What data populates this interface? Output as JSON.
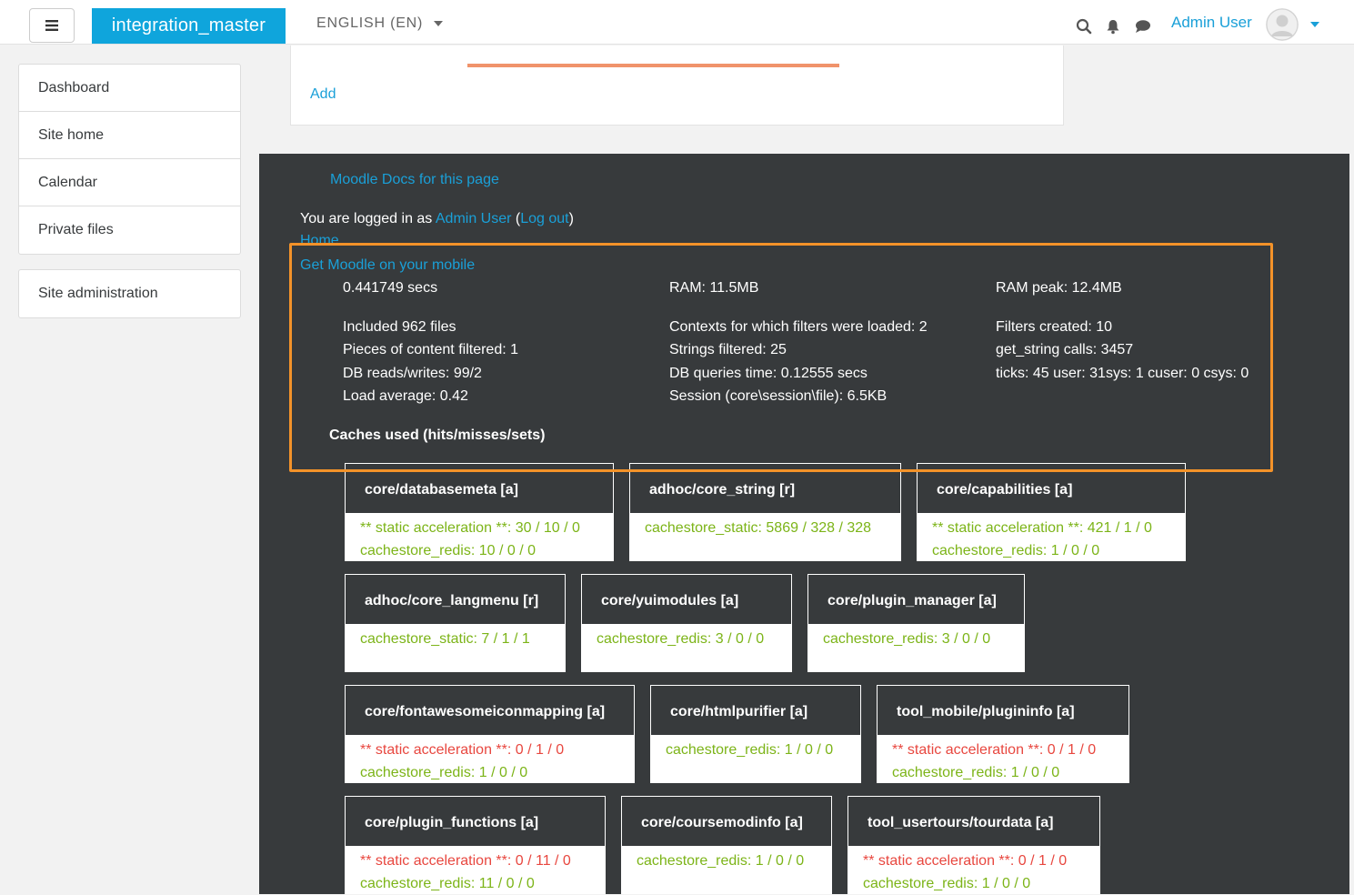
{
  "navbar": {
    "brand": "integration_master",
    "language": "ENGLISH (EN)",
    "user_name": "Admin User",
    "icons": [
      "hamburger-icon",
      "search-icon",
      "bell-icon",
      "chat-icon",
      "avatar-icon",
      "chevron-down-icon"
    ]
  },
  "sidebar": {
    "items": [
      "Dashboard",
      "Site home",
      "Calendar",
      "Private files"
    ],
    "admin": "Site administration"
  },
  "content": {
    "add_label": "Add"
  },
  "footer": {
    "docs_link": "Moodle Docs for this page",
    "logged_in_prefix": "You are logged in as ",
    "logged_in_user": "Admin User",
    "paren_open": " (",
    "logout": "Log out",
    "paren_close": ")",
    "home_link": "Home",
    "mobile_link": "Get Moodle on your mobile"
  },
  "performance": {
    "col1": [
      "0.441749 secs",
      "Included 962 files",
      "Pieces of content filtered: 1",
      "DB reads/writes: 99/2",
      "Load average: 0.42"
    ],
    "col2": [
      "RAM: 11.5MB",
      "Contexts for which filters were loaded: 2",
      "Strings filtered: 25",
      "DB queries time: 0.12555 secs",
      "Session (core\\session\\file): 6.5KB"
    ],
    "col3": [
      "RAM peak: 12.4MB",
      "Filters created: 10",
      "get_string calls: 3457",
      "ticks: 45 user: 31sys: 1 cuser: 0 csys: 0"
    ],
    "caches_title": "Caches used (hits/misses/sets)"
  },
  "caches": [
    {
      "name": "core/databasemeta [a]",
      "lines": [
        {
          "text": "** static acceleration **: 30 / 10 / 0",
          "status": "green"
        },
        {
          "text": "cachestore_redis: 10 / 0 / 0",
          "status": "green"
        }
      ]
    },
    {
      "name": "adhoc/core_string [r]",
      "lines": [
        {
          "text": "cachestore_static: 5869 / 328 / 328",
          "status": "green"
        }
      ]
    },
    {
      "name": "core/capabilities [a]",
      "lines": [
        {
          "text": "** static acceleration **: 421 / 1 / 0",
          "status": "green"
        },
        {
          "text": "cachestore_redis: 1 / 0 / 0",
          "status": "green"
        }
      ]
    },
    {
      "name": "adhoc/core_langmenu [r]",
      "lines": [
        {
          "text": "cachestore_static: 7 / 1 / 1",
          "status": "green"
        }
      ]
    },
    {
      "name": "core/yuimodules [a]",
      "lines": [
        {
          "text": "cachestore_redis: 3 / 0 / 0",
          "status": "green"
        }
      ]
    },
    {
      "name": "core/plugin_manager [a]",
      "lines": [
        {
          "text": "cachestore_redis: 3 / 0 / 0",
          "status": "green"
        }
      ]
    },
    {
      "name": "core/fontawesomeiconmapping [a]",
      "lines": [
        {
          "text": "** static acceleration **: 0 / 1 / 0",
          "status": "red"
        },
        {
          "text": "cachestore_redis: 1 / 0 / 0",
          "status": "green"
        }
      ]
    },
    {
      "name": "core/htmlpurifier [a]",
      "lines": [
        {
          "text": "cachestore_redis: 1 / 0 / 0",
          "status": "green"
        }
      ]
    },
    {
      "name": "tool_mobile/plugininfo [a]",
      "lines": [
        {
          "text": "** static acceleration **: 0 / 1 / 0",
          "status": "red"
        },
        {
          "text": "cachestore_redis: 1 / 0 / 0",
          "status": "green"
        }
      ]
    },
    {
      "name": "core/plugin_functions [a]",
      "lines": [
        {
          "text": "** static acceleration **: 0 / 11 / 0",
          "status": "red"
        },
        {
          "text": "cachestore_redis: 11 / 0 / 0",
          "status": "green"
        }
      ]
    },
    {
      "name": "core/coursemodinfo [a]",
      "lines": [
        {
          "text": "cachestore_redis: 1 / 0 / 0",
          "status": "green"
        }
      ]
    },
    {
      "name": "tool_usertours/tourdata [a]",
      "lines": [
        {
          "text": "** static acceleration **: 0 / 1 / 0",
          "status": "red"
        },
        {
          "text": "cachestore_redis: 1 / 0 / 0",
          "status": "green"
        }
      ]
    }
  ],
  "colors": {
    "brand": "#0fa5dc",
    "link": "#1aa0d8",
    "footer_bg": "#373a3c",
    "hit": "#7cb418",
    "miss": "#e8473f",
    "highlight": "#f39229",
    "progress": "#f0936b"
  }
}
